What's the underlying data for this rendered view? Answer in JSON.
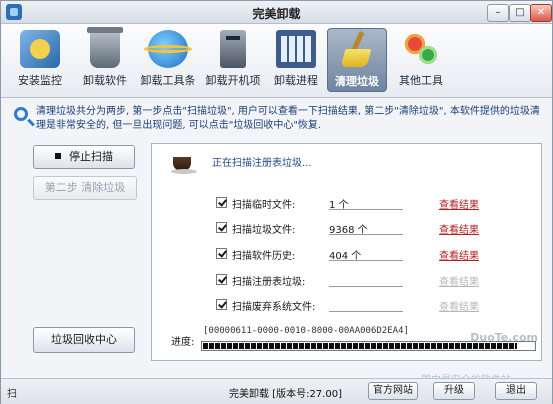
{
  "window": {
    "title": "完美卸载",
    "min_label": "–",
    "max_label": "□",
    "close_label": "✕"
  },
  "toolbar": {
    "items": [
      {
        "label": "安装监控",
        "icon": "monitor-icon"
      },
      {
        "label": "卸载软件",
        "icon": "trash-icon"
      },
      {
        "label": "卸载工具条",
        "icon": "ie-icon"
      },
      {
        "label": "卸载开机项",
        "icon": "computer-icon"
      },
      {
        "label": "卸载进程",
        "icon": "process-grid-icon"
      },
      {
        "label": "清理垃圾",
        "icon": "broom-icon",
        "active": true
      },
      {
        "label": "其他工具",
        "icon": "gears-icon"
      }
    ]
  },
  "info": {
    "text": "清理垃圾共分为两步, 第一步点击\"扫描垃圾\", 用户可以查看一下扫描结果, 第二步\"清除垃圾\", 本软件提供的垃圾清理是非常安全的, 但一旦出现问题, 可以点击\"垃圾回收中心\"恢复."
  },
  "left": {
    "stop_label": "停止扫描",
    "step2_label": "第二步  清除垃圾",
    "recycle_label": "垃圾回收中心"
  },
  "scan": {
    "status": "正在扫描注册表垃圾...",
    "rows": [
      {
        "label": "扫描临时文件:",
        "value": "1 个",
        "link": "查看结果",
        "enabled": true
      },
      {
        "label": "扫描垃圾文件:",
        "value": "9368 个",
        "link": "查看结果",
        "enabled": true
      },
      {
        "label": "扫描软件历史:",
        "value": "404 个",
        "link": "查看结果",
        "enabled": true
      },
      {
        "label": "扫描注册表垃圾:",
        "value": "",
        "link": "查看结果",
        "enabled": false
      },
      {
        "label": "扫描废弃系统文件:",
        "value": "",
        "link": "查看结果",
        "enabled": false
      }
    ],
    "progress_label": "进度:",
    "progress_id": "[00000611-0000-0010-8000-00AA006D2EA4]",
    "progress": 0.95
  },
  "watermark": {
    "site": "DuoTe.com",
    "brand": "多特软件站",
    "tagline": "国内最安全的软件站"
  },
  "statusbar": {
    "left_text": "扫",
    "version_text": "完美卸载 [版本号:27.00]",
    "site_label": "官方网站",
    "upgrade_label": "升级",
    "exit_label": "退出"
  }
}
